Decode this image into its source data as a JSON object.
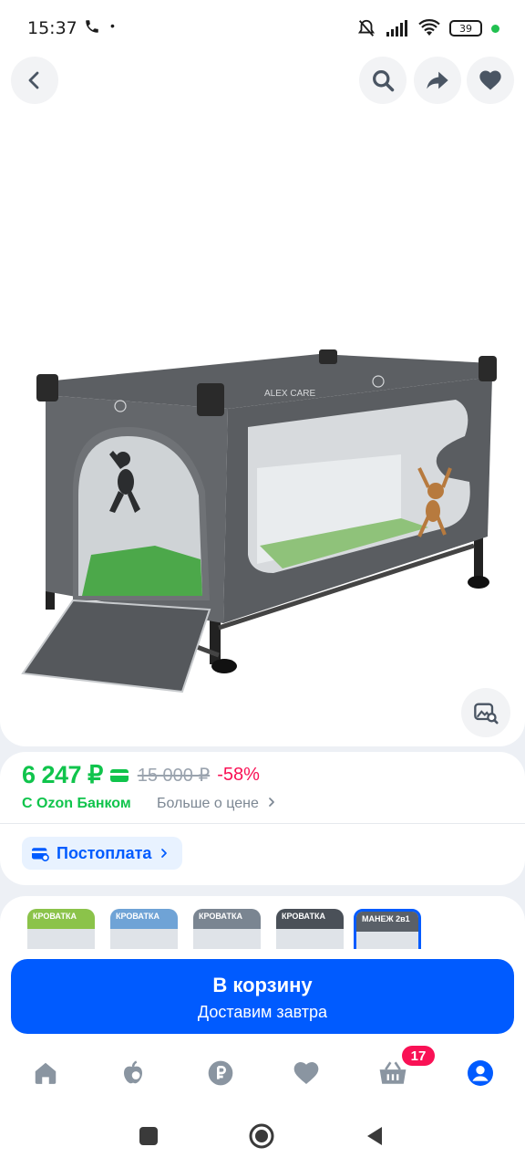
{
  "status_bar": {
    "time": "15:37",
    "phone_icon": "phone-icon",
    "dot": "•",
    "battery": "39"
  },
  "toolbar": {
    "back_icon": "chevron-left-icon",
    "search_icon": "search-icon",
    "share_icon": "share-icon",
    "favorite_icon": "heart-icon"
  },
  "product": {
    "photo_brand": "ALEX CARE",
    "photo_search_icon": "image-search-icon"
  },
  "price": {
    "current": "6 247 ₽",
    "old": "15 000 ₽",
    "discount": "-58%",
    "bank_label": "С Ozon Банком",
    "more_label": "Больше о цене",
    "postpay_label": "Постоплата"
  },
  "thumbnails": [
    {
      "label": "КРОВАТКА",
      "color": "#8bc34a"
    },
    {
      "label": "КРОВАТКА",
      "color": "#6fa3d6"
    },
    {
      "label": "КРОВАТКА",
      "color": "#7a8591"
    },
    {
      "label": "КРОВАТКА",
      "color": "#4a5058"
    },
    {
      "label": "МАНЕЖ 2в1",
      "color": "#5a6068"
    }
  ],
  "cart": {
    "title": "В корзину",
    "subtitle": "Доставим завтра"
  },
  "nav": {
    "cart_badge": "17"
  },
  "colors": {
    "accent": "#005bff",
    "price_green": "#10c44c",
    "discount_pink": "#f91155"
  }
}
